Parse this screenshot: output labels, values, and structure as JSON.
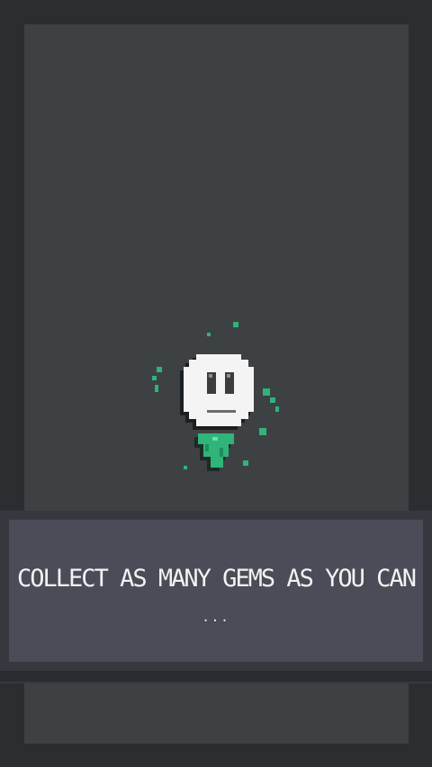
{
  "tutorial": {
    "message": "Collect as many gems as you can",
    "continue_indicator": "..."
  },
  "player": {
    "character": "round-face-on-green-gem"
  },
  "colors": {
    "background": "#2b2e31",
    "playfield": "#3e4143",
    "banner": "#4a4c57",
    "gem_green": "#2fb47a",
    "face_white": "#f4f4f4",
    "text": "#f2f2f2"
  }
}
